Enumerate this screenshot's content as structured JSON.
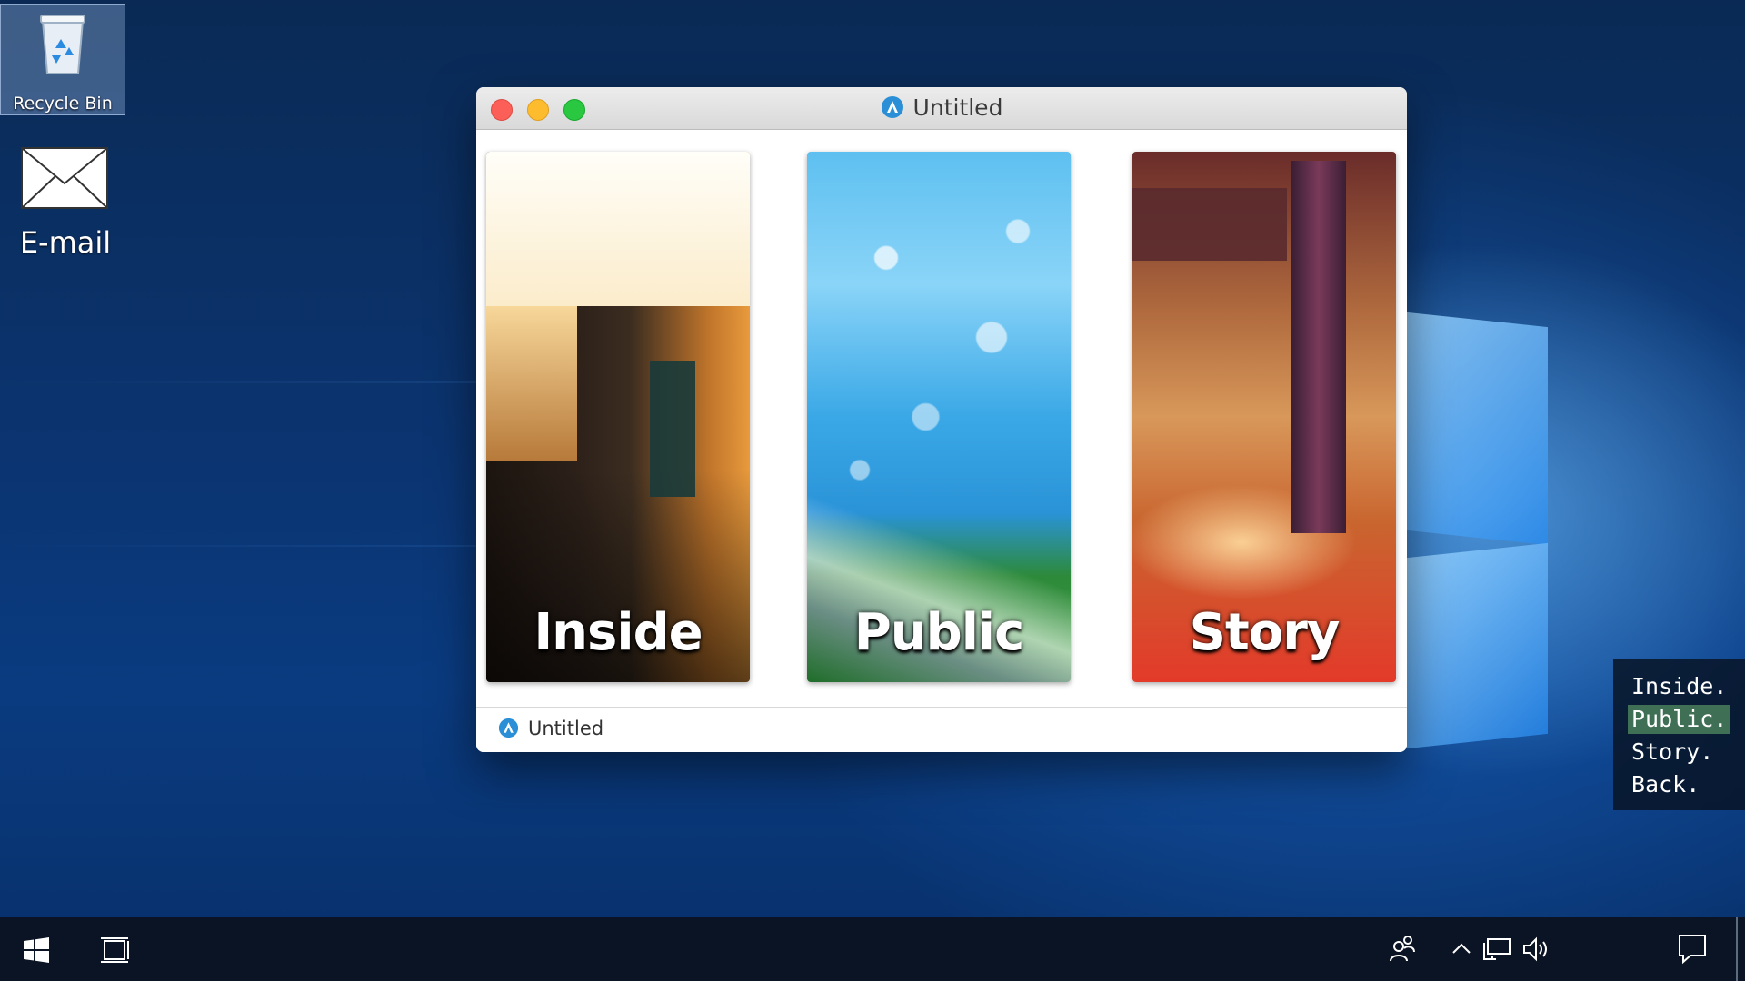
{
  "desktop": {
    "icons": [
      {
        "label": "Recycle Bin"
      },
      {
        "label": "E-mail"
      }
    ]
  },
  "window": {
    "title": "Untitled",
    "status_text": "Untitled",
    "cards": [
      {
        "label": "Inside"
      },
      {
        "label": "Public"
      },
      {
        "label": "Story"
      }
    ]
  },
  "menu": {
    "options": [
      {
        "label": "Inside.",
        "selected": false
      },
      {
        "label": "Public.",
        "selected": true
      },
      {
        "label": "Story.",
        "selected": false
      },
      {
        "label": "Back.",
        "selected": false
      }
    ]
  },
  "colors": {
    "desktop_bg": "#0a3b80",
    "close": "#fc5f57",
    "minimize": "#fdbc2e",
    "maximize": "#29c840",
    "menu_highlight": "#3f6f54",
    "taskbar": "#0b1424"
  },
  "taskbar": {
    "icons": [
      "windows-start-icon",
      "task-view-icon",
      "people-icon",
      "chevron-up-icon",
      "network-icon",
      "volume-icon",
      "notification-icon"
    ]
  }
}
